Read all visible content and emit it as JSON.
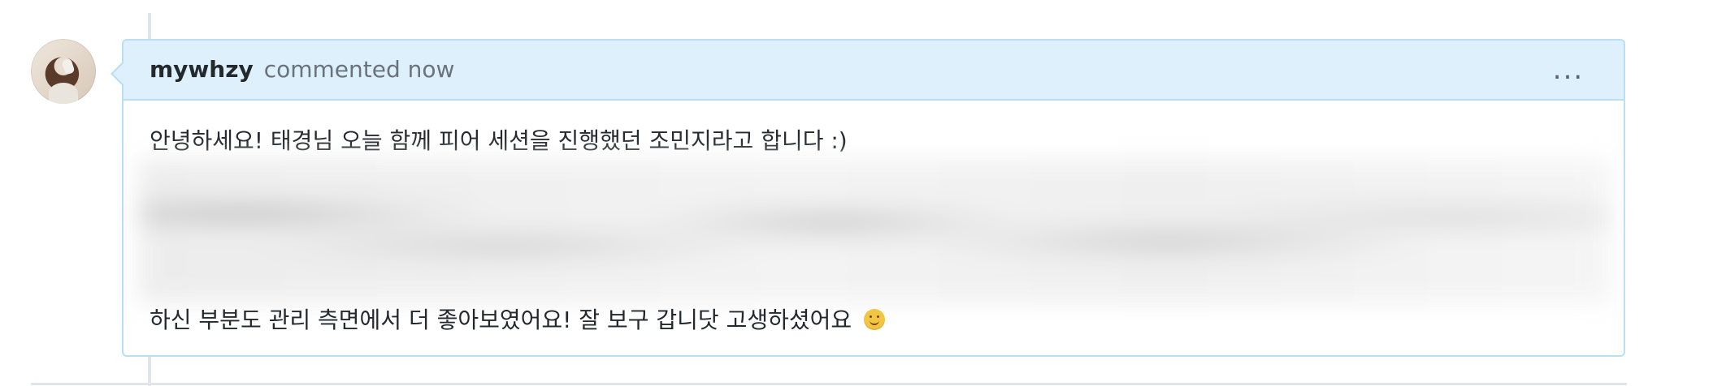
{
  "comment": {
    "author": "mywhzy",
    "meta": "commented now",
    "more_button_label": "...",
    "body": {
      "line_1": "안녕하세요! 태경님 오늘 함께 피어 세션을 진행했던 조민지라고 합니다 :)",
      "line_2": "하신 부분도 관리 측면에서 더 좋아보였어요! 잘 보구 갑니닷 고생하셨어요"
    },
    "emoji": "smiling-face-icon"
  },
  "colors": {
    "header_background": "#ddf0fb",
    "border": "#b9dff4",
    "author_text": "#24292e",
    "meta_text": "#6a737d"
  }
}
